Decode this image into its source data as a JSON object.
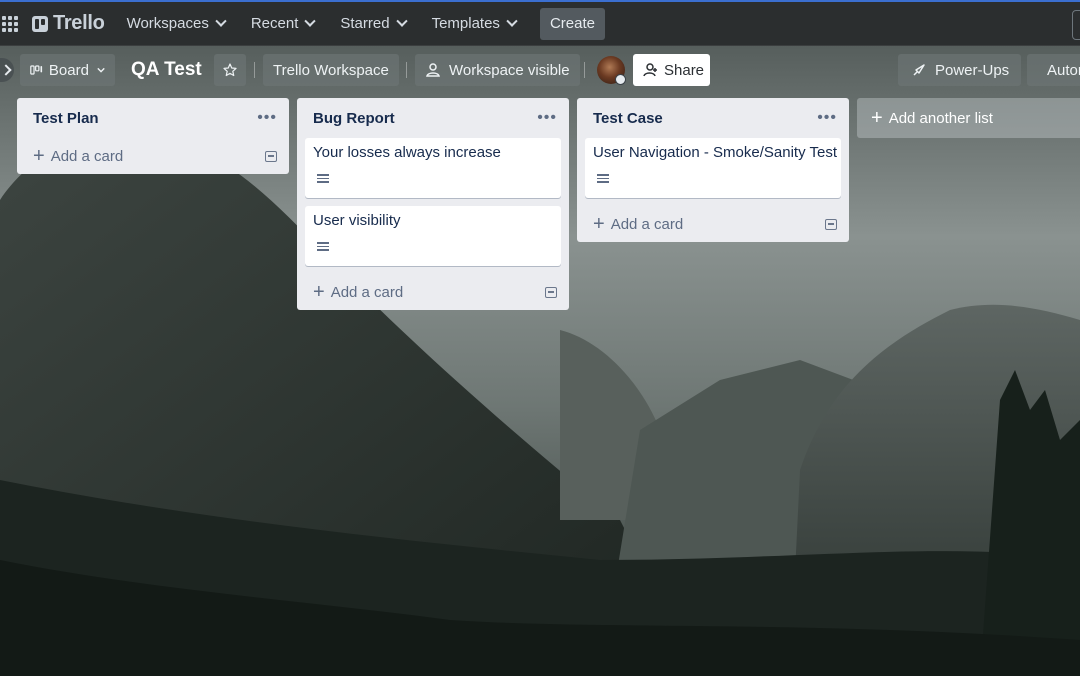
{
  "topnav": {
    "logo": "Trello",
    "menus": [
      "Workspaces",
      "Recent",
      "Starred",
      "Templates"
    ],
    "create_label": "Create"
  },
  "board": {
    "view_label": "Board",
    "title": "QA Test",
    "workspace_label": "Trello Workspace",
    "visibility_label": "Workspace visible",
    "share_label": "Share",
    "powerups_label": "Power-Ups",
    "automation_label": "Automation"
  },
  "lists": [
    {
      "title": "Test Plan",
      "cards": []
    },
    {
      "title": "Bug Report",
      "cards": [
        "Your losses always increase",
        "User visibility"
      ]
    },
    {
      "title": "Test Case",
      "cards": [
        "User Navigation - Smoke/Sanity Test"
      ]
    }
  ],
  "add_card_label": "Add a card",
  "add_list_label": "Add another list",
  "colors": {
    "nav_bg": "#2b2e2f",
    "list_bg": "#ebecf0",
    "card_bg": "#ffffff",
    "accent": "#3b6fd0"
  },
  "icons": [
    "apps-grid-icon",
    "trello-logo-icon",
    "chevron-down-icon",
    "board-icon",
    "star-icon",
    "people-icon",
    "add-person-icon",
    "rocket-icon",
    "lightning-icon",
    "more-icon",
    "plus-icon",
    "description-icon",
    "template-icon"
  ]
}
